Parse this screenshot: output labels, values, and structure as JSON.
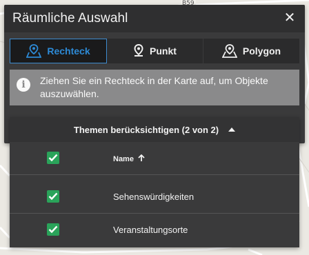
{
  "map": {
    "road_badge": "B59"
  },
  "dialog": {
    "title": "Räumliche Auswahl",
    "close_icon": "close-icon",
    "tabs": [
      {
        "label": "Rechteck",
        "icon": "map-rectangle-icon",
        "active": true
      },
      {
        "label": "Punkt",
        "icon": "map-pin-icon",
        "active": false
      },
      {
        "label": "Polygon",
        "icon": "map-polygon-icon",
        "active": false
      }
    ],
    "info_text": "Ziehen Sie ein Rechteck in der Karte auf, um Objekte auszuwählen.",
    "info_icon": "info-icon"
  },
  "themes": {
    "header": "Themen berücksichtigen (2 von 2)",
    "column_name": "Name",
    "sort_icon": "arrow-up-icon",
    "rows": [
      {
        "label": "Sehenswürdigkeiten",
        "checked": true
      },
      {
        "label": "Veranstaltungsorte",
        "checked": true
      }
    ],
    "header_checked": true
  },
  "colors": {
    "accent_blue": "#2d8ad6",
    "checkbox_green": "#2aa35a",
    "panel_dark": "#3a3a3b"
  }
}
